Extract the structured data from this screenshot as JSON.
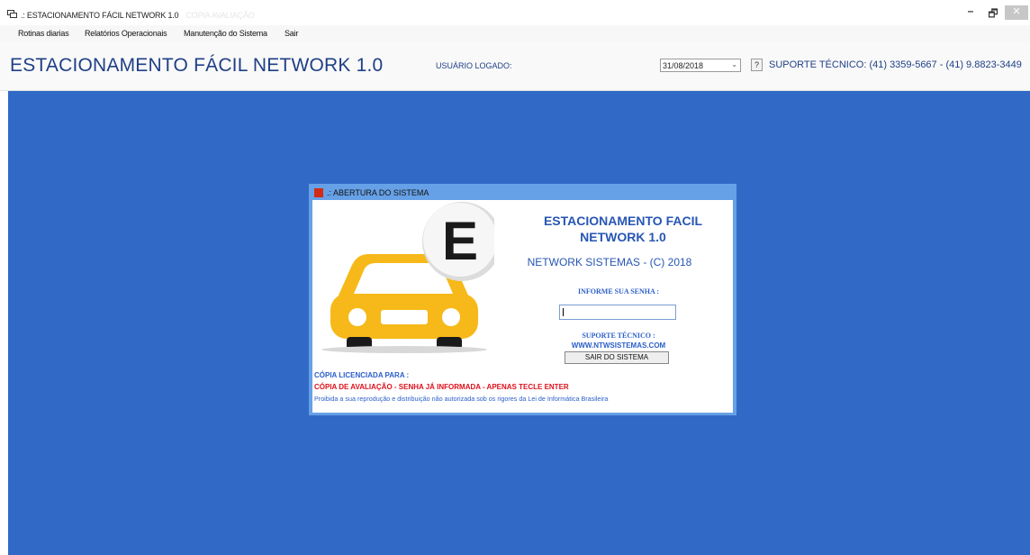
{
  "window": {
    "title": ".: ESTACIONAMENTO FÁCIL NETWORK 1.0",
    "title_ghost": "COPIA AVALIAÇÃO",
    "minimize_glyph": "–",
    "maximize_glyph": "🗗",
    "close_glyph": "✕"
  },
  "menu": {
    "items": [
      "Rotinas diarias",
      "Relatórios Operacionais",
      "Manutenção do Sistema",
      "Sair"
    ]
  },
  "header": {
    "app_title": "ESTACIONAMENTO FÁCIL NETWORK 1.0",
    "user_label": "USUÁRIO LOGADO:",
    "date_value": "31/08/2018",
    "help_label": "?",
    "support_text": "SUPORTE TÉCNICO: (41) 3359-5667 - (41) 9.8823-3449"
  },
  "dialog": {
    "title": ".: ABERTURA DO SISTEMA",
    "logo_letter": "E",
    "brand_line1": "ESTACIONAMENTO FACIL",
    "brand_line2": "NETWORK 1.0",
    "company": "NETWORK SISTEMAS - (C) 2018",
    "password_label": "INFORME SUA SENHA :",
    "password_value": "",
    "support_label": "SUPORTE TÉCNICO :",
    "support_url": "WWW.NTWSISTEMAS.COM",
    "exit_button": "SAIR DO SISTEMA",
    "license_label": "CÓPIA LICENCIADA PARA :",
    "evaluation_notice": "CÓPIA DE AVALIAÇÃO - SENHA JÁ INFORMADA - APENAS TECLE ENTER",
    "legal_notice": "Proibida a sua reprodução e distribuição não autorizada sob os rigores da Lei de Informática Brasileira"
  },
  "colors": {
    "desktop": "#3169c6",
    "dialog_frame": "#66a0e6",
    "brand_blue": "#2756b3",
    "warning_red": "#e0101b",
    "car_yellow": "#f6b919"
  }
}
